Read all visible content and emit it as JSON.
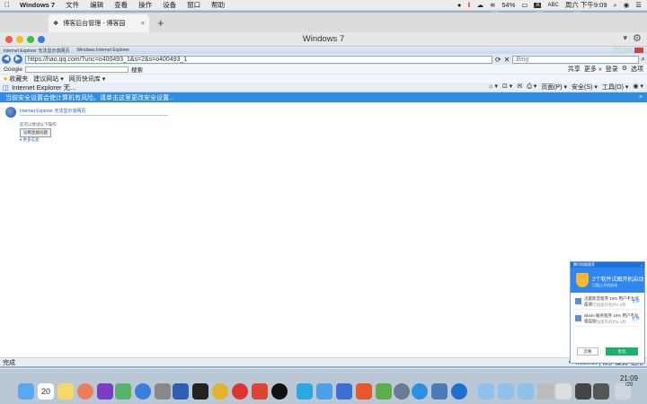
{
  "menubar": {
    "apple": "",
    "items": [
      "Windows 7",
      "文件",
      "编辑",
      "查看",
      "操作",
      "设备",
      "窗口",
      "帮助"
    ],
    "battery": "54%",
    "input_abbr": "A",
    "input": "ABC",
    "datetime": "周六 下午9:09"
  },
  "browser": {
    "tab_title": "博客后台管理 - 博客园",
    "tab_close": "×",
    "new_tab": "+",
    "window_title": "Windows 7",
    "menu_chevron": "▾",
    "extension": "⚙"
  },
  "ie": {
    "title": "Internet Explorer 无法显示该网页",
    "subtitle": "Windows Internet Explorer",
    "back": "◀",
    "forward": "▶",
    "url": "https://hao.qq.com/?unc=o400493_1&s=2&s=o400493_1",
    "search_placeholder": "Bing",
    "google_label": "Google",
    "search_btn": "搜索",
    "right_links": [
      "共享",
      "更多 »",
      "登录"
    ],
    "settings": "选项",
    "favorites": "收藏夹",
    "fav_items": [
      "建议网站 ▾",
      "网页快讯库 ▾"
    ],
    "active_tab": "Internet Explorer 无...",
    "tools": [
      "页面(P) ▾",
      "安全(S) ▾",
      "工具(O) ▾",
      "◉ ▾"
    ],
    "infobar": "当前安全设置会使计算机有风险。请单击这里更改安全设置...",
    "infobar_close": "×",
    "error_title": "Internet Explorer 无法显示该网页",
    "error_tip": "您可以尝试以下操作：",
    "error_btn": "诊断连接问题",
    "error_more": "▾ 更多信息",
    "status": "完成",
    "zone": "Internet | 保护模式: 启用"
  },
  "popup": {
    "header": "腾讯电脑管家",
    "close": "×",
    "title": "2个软件试图开机启动",
    "subtitle": "已阻止开机启动",
    "items": [
      {
        "t1": "迅雷影音程序 10% 用户不允许启动",
        "t2": "每天可加速开机约0.3秒",
        "act": "允许"
      },
      {
        "t1": "wbxm 服务程序 10% 用户不允许启动",
        "t2": "每天可加速开机约0.1秒",
        "act": "允许"
      }
    ],
    "ignore": "忽略",
    "fix": "优化"
  },
  "clock": {
    "time": "21:09",
    "date": "/20"
  },
  "dock_calendar": "20",
  "colors": {
    "accent": "#2e8ce3",
    "popup_blue": "#2f86ee",
    "green": "#19b36b"
  }
}
